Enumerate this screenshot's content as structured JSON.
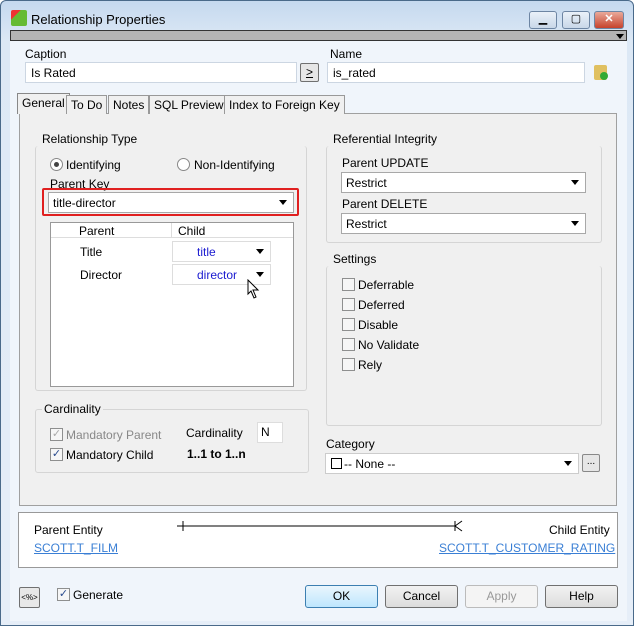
{
  "window": {
    "title": "Relationship Properties"
  },
  "caption": {
    "label": "Caption",
    "value": "Is Rated",
    "copy_button": ">"
  },
  "name": {
    "label": "Name",
    "value": "is_rated"
  },
  "tabs": [
    "General",
    "To Do",
    "Notes",
    "SQL Preview",
    "Index to Foreign Key"
  ],
  "relationship_type": {
    "label": "Relationship Type",
    "identifying": "Identifying",
    "non_identifying": "Non-Identifying",
    "selected": "Identifying"
  },
  "parent_key": {
    "label": "Parent Key",
    "value": "title-director"
  },
  "key_table": {
    "headers": [
      "Parent",
      "Child"
    ],
    "rows": [
      {
        "parent": "Title",
        "child": "title"
      },
      {
        "parent": "Director",
        "child": "director"
      }
    ]
  },
  "referential_integrity": {
    "label": "Referential Integrity",
    "update_label": "Parent UPDATE",
    "update_value": "Restrict",
    "delete_label": "Parent DELETE",
    "delete_value": "Restrict"
  },
  "settings": {
    "label": "Settings",
    "items": [
      {
        "label": "Deferrable",
        "checked": false
      },
      {
        "label": "Deferred",
        "checked": false
      },
      {
        "label": "Disable",
        "checked": false
      },
      {
        "label": "No Validate",
        "checked": false
      },
      {
        "label": "Rely",
        "checked": false
      }
    ]
  },
  "cardinality": {
    "label": "Cardinality",
    "mandatory_parent": "Mandatory Parent",
    "mandatory_child": "Mandatory Child",
    "cardinality_label": "Cardinality",
    "cardinality_value": "N",
    "summary": "1..1 to 1..n"
  },
  "category": {
    "label": "Category",
    "value": "-- None --",
    "browse": "..."
  },
  "entities": {
    "parent_label": "Parent Entity",
    "parent_value": "SCOTT.T_FILM",
    "child_label": "Child Entity",
    "child_value": "SCOTT.T_CUSTOMER_RATING"
  },
  "footer": {
    "macro": "<%>",
    "generate": "Generate",
    "ok": "OK",
    "cancel": "Cancel",
    "apply": "Apply",
    "help": "Help"
  }
}
